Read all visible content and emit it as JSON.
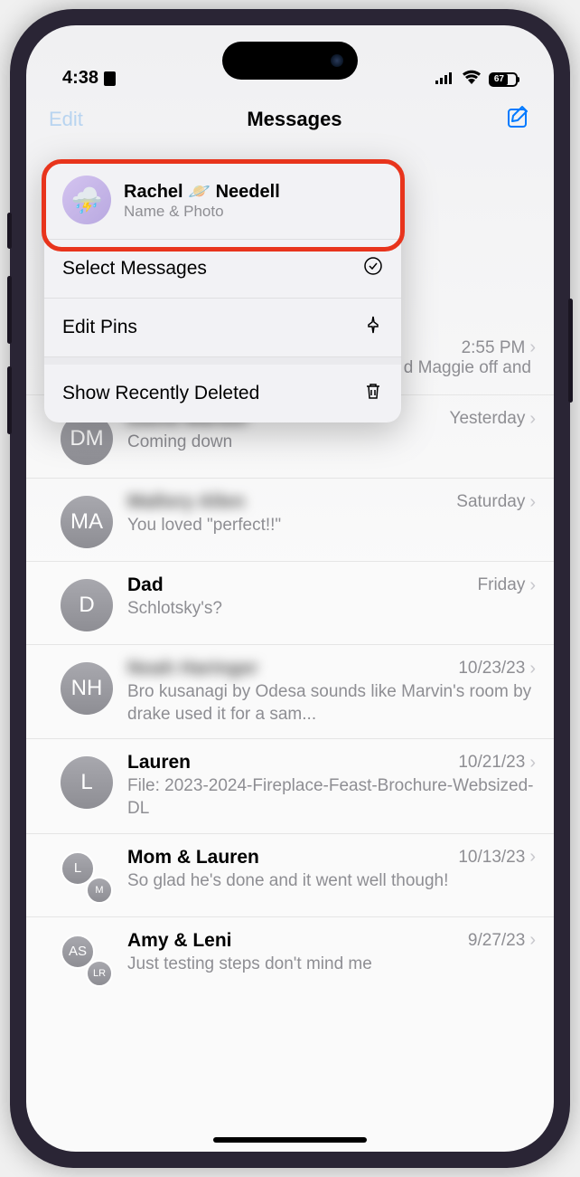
{
  "status_bar": {
    "time": "4:38",
    "battery": "67"
  },
  "nav": {
    "edit": "Edit",
    "title": "Messages"
  },
  "edit_menu": {
    "profile_name": "Rachel 🪐 Needell",
    "profile_sub": "Name & Photo",
    "select_messages": "Select Messages",
    "edit_pins": "Edit Pins",
    "show_deleted": "Show Recently Deleted"
  },
  "messages": [
    {
      "time": "2:55 PM",
      "partial_preview": "d Maggie off and"
    },
    {
      "avatar": "DM",
      "name": "David Mardor",
      "name_blurred": true,
      "time": "Yesterday",
      "preview": "Coming down"
    },
    {
      "avatar": "MA",
      "name": "Mallory Allen",
      "name_blurred": true,
      "time": "Saturday",
      "preview": "You loved \"perfect!!\""
    },
    {
      "avatar": "D",
      "name": "Dad",
      "time": "Friday",
      "preview": "Schlotsky's?"
    },
    {
      "avatar": "NH",
      "name": "Noah Haringer",
      "name_blurred": true,
      "time": "10/23/23",
      "preview": "Bro kusanagi by Odesa sounds like Marvin's room by drake used it for a sam..."
    },
    {
      "avatar": "L",
      "name": "Lauren",
      "time": "10/21/23",
      "preview": "File: 2023-2024-Fireplace-Feast-Brochure-Websized-DL"
    },
    {
      "avatar_group": [
        "L",
        "M"
      ],
      "name": "Mom & Lauren",
      "time": "10/13/23",
      "preview": "So glad he's done and it went well though!"
    },
    {
      "avatar_group": [
        "AS",
        "LR"
      ],
      "name": "Amy & Leni",
      "time": "9/27/23",
      "preview": "Just testing steps don't mind me"
    }
  ]
}
